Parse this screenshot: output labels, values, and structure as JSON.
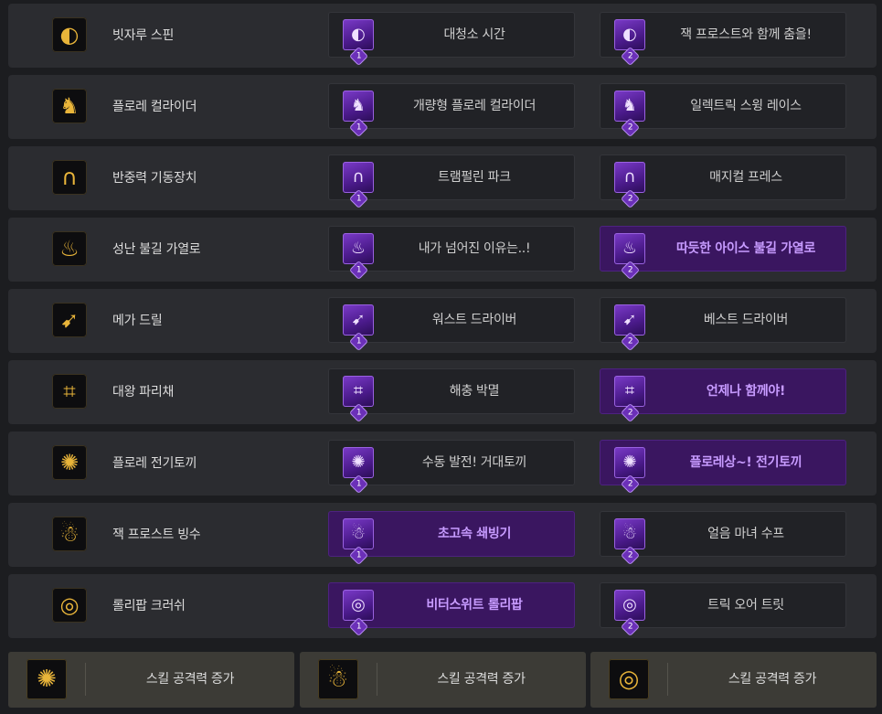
{
  "rows": [
    {
      "skill": "빗자루 스핀",
      "icon": "broom-spin-icon",
      "opt1": {
        "label": "대청소 시간",
        "tier": "1",
        "selected": false
      },
      "opt2": {
        "label": "잭 프로스트와 함께 춤을!",
        "tier": "2",
        "selected": false
      }
    },
    {
      "skill": "플로레 컬라이더",
      "icon": "flore-collider-icon",
      "opt1": {
        "label": "개량형 플로레 컬라이더",
        "tier": "1",
        "selected": false
      },
      "opt2": {
        "label": "일렉트릭 스윙 레이스",
        "tier": "2",
        "selected": false
      }
    },
    {
      "skill": "반중력 기동장치",
      "icon": "antigravity-device-icon",
      "opt1": {
        "label": "트램펄린 파크",
        "tier": "1",
        "selected": false
      },
      "opt2": {
        "label": "매지컬 프레스",
        "tier": "2",
        "selected": false
      }
    },
    {
      "skill": "성난 불길 가열로",
      "icon": "furnace-icon",
      "opt1": {
        "label": "내가 넘어진 이유는..!",
        "tier": "1",
        "selected": false
      },
      "opt2": {
        "label": "따듯한 아이스 불길 가열로",
        "tier": "2",
        "selected": true
      }
    },
    {
      "skill": "메가 드릴",
      "icon": "mega-drill-icon",
      "opt1": {
        "label": "워스트 드라이버",
        "tier": "1",
        "selected": false
      },
      "opt2": {
        "label": "베스트 드라이버",
        "tier": "2",
        "selected": false
      }
    },
    {
      "skill": "대왕 파리채",
      "icon": "fly-swatter-icon",
      "opt1": {
        "label": "해충 박멸",
        "tier": "1",
        "selected": false
      },
      "opt2": {
        "label": "언제나 함께야!",
        "tier": "2",
        "selected": true
      }
    },
    {
      "skill": "플로레 전기토끼",
      "icon": "electric-rabbit-icon",
      "opt1": {
        "label": "수동 발전! 거대토끼",
        "tier": "1",
        "selected": false
      },
      "opt2": {
        "label": "플로레상~! 전기토끼",
        "tier": "2",
        "selected": true
      }
    },
    {
      "skill": "잭 프로스트 빙수",
      "icon": "shaved-ice-icon",
      "opt1": {
        "label": "초고속 쇄빙기",
        "tier": "1",
        "selected": true
      },
      "opt2": {
        "label": "얼음 마녀 수프",
        "tier": "2",
        "selected": false
      }
    },
    {
      "skill": "롤리팝 크러쉬",
      "icon": "lollipop-icon",
      "opt1": {
        "label": "비터스위트 롤리팝",
        "tier": "1",
        "selected": true
      },
      "opt2": {
        "label": "트릭 오어 트릿",
        "tier": "2",
        "selected": false
      }
    }
  ],
  "bottom": [
    {
      "label": "스킬 공격력 증가",
      "icon": "electric-rabbit-icon"
    },
    {
      "label": "스킬 공격력 증가",
      "icon": "shaved-ice-icon"
    },
    {
      "label": "스킬 공격력 증가",
      "icon": "lollipop-icon"
    }
  ],
  "glyphs": {
    "broom-spin-icon": "◐",
    "flore-collider-icon": "♞",
    "antigravity-device-icon": "∩",
    "furnace-icon": "♨",
    "mega-drill-icon": "➹",
    "fly-swatter-icon": "⌗",
    "electric-rabbit-icon": "✺",
    "shaved-ice-icon": "☃",
    "lollipop-icon": "◎"
  }
}
